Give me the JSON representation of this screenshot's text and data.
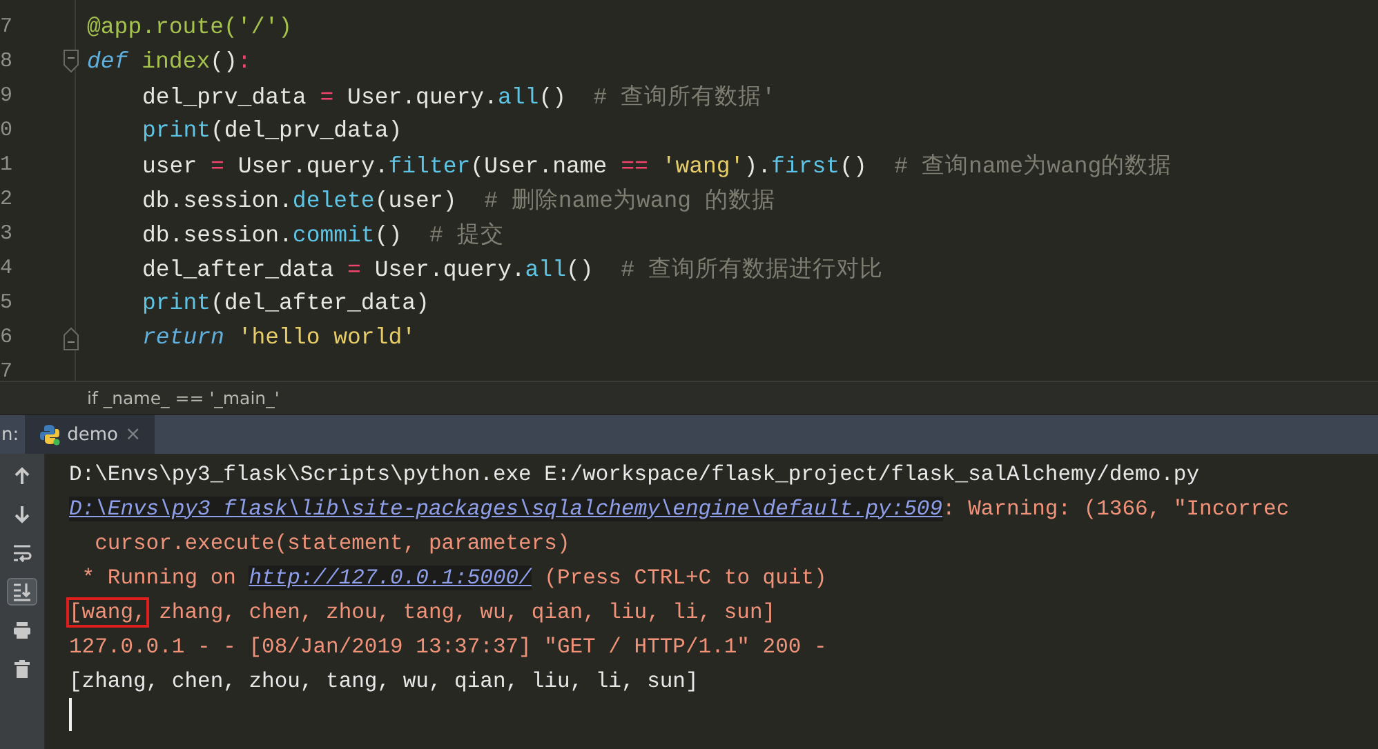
{
  "editor": {
    "lines": [
      {
        "number": "7",
        "kind": "code",
        "indented": false,
        "tokens": [
          {
            "text": "@app.route('/')",
            "kind": "deco"
          }
        ]
      },
      {
        "number": "8",
        "kind": "fold-start",
        "indented": false,
        "tokens": [
          {
            "text": "def ",
            "kind": "kw"
          },
          {
            "text": "index",
            "kind": "fn"
          },
          {
            "text": "()",
            "kind": "text"
          },
          {
            "text": ":",
            "kind": "op"
          }
        ]
      },
      {
        "number": "9",
        "kind": "code",
        "indented": true,
        "tokens": [
          {
            "text": "del_prv_data ",
            "kind": "text"
          },
          {
            "text": "=",
            "kind": "op"
          },
          {
            "text": " User.query.",
            "kind": "text"
          },
          {
            "text": "all",
            "kind": "builtin"
          },
          {
            "text": "()  ",
            "kind": "text"
          },
          {
            "text": "# 查询所有数据'",
            "kind": "comment"
          }
        ]
      },
      {
        "number": "0",
        "kind": "code",
        "indented": true,
        "tokens": [
          {
            "text": "print",
            "kind": "builtin"
          },
          {
            "text": "(del_prv_data)",
            "kind": "text"
          }
        ]
      },
      {
        "number": "1",
        "kind": "code",
        "indented": true,
        "tokens": [
          {
            "text": "user ",
            "kind": "text"
          },
          {
            "text": "=",
            "kind": "op"
          },
          {
            "text": " User.query.",
            "kind": "text"
          },
          {
            "text": "filter",
            "kind": "builtin"
          },
          {
            "text": "(User.name ",
            "kind": "text"
          },
          {
            "text": "== ",
            "kind": "op"
          },
          {
            "text": "'wang'",
            "kind": "str"
          },
          {
            "text": ").",
            "kind": "text"
          },
          {
            "text": "first",
            "kind": "builtin"
          },
          {
            "text": "()  ",
            "kind": "text"
          },
          {
            "text": "# 查询name为wang的数据",
            "kind": "comment"
          }
        ]
      },
      {
        "number": "2",
        "kind": "code",
        "indented": true,
        "tokens": [
          {
            "text": "db.session.",
            "kind": "text"
          },
          {
            "text": "delete",
            "kind": "builtin"
          },
          {
            "text": "(user)  ",
            "kind": "text"
          },
          {
            "text": "# 删除name为wang 的数据",
            "kind": "comment"
          }
        ]
      },
      {
        "number": "3",
        "kind": "code",
        "indented": true,
        "tokens": [
          {
            "text": "db.session.",
            "kind": "text"
          },
          {
            "text": "commit",
            "kind": "builtin"
          },
          {
            "text": "()  ",
            "kind": "text"
          },
          {
            "text": "# 提交",
            "kind": "comment"
          }
        ]
      },
      {
        "number": "4",
        "kind": "code",
        "indented": true,
        "tokens": [
          {
            "text": "del_after_data ",
            "kind": "text"
          },
          {
            "text": "=",
            "kind": "op"
          },
          {
            "text": " User.query.",
            "kind": "text"
          },
          {
            "text": "all",
            "kind": "builtin"
          },
          {
            "text": "()  ",
            "kind": "text"
          },
          {
            "text": "# 查询所有数据进行对比",
            "kind": "comment"
          }
        ]
      },
      {
        "number": "5",
        "kind": "code",
        "indented": true,
        "tokens": [
          {
            "text": "print",
            "kind": "builtin"
          },
          {
            "text": "(del_after_data)",
            "kind": "text"
          }
        ]
      },
      {
        "number": "6",
        "kind": "fold-end",
        "indented": true,
        "tokens": [
          {
            "text": "return ",
            "kind": "kw"
          },
          {
            "text": "'hello world'",
            "kind": "str"
          }
        ]
      },
      {
        "number": "7",
        "kind": "code"
      }
    ],
    "breadcrumb": "if _name_ == '_main_'"
  },
  "run_panel": {
    "label": "n:",
    "tabs": [
      {
        "label": "demo",
        "close": "×",
        "selected": true
      }
    ],
    "toolbar": [
      {
        "kind": "up",
        "selected": false
      },
      {
        "kind": "down",
        "selected": false
      },
      {
        "kind": "wrap",
        "selected": false
      },
      {
        "kind": "scroll-end",
        "selected": true
      },
      {
        "kind": "print",
        "selected": false
      },
      {
        "kind": "trash",
        "selected": false
      }
    ],
    "console": [
      [
        {
          "text": "D:\\Envs\\py3_flask\\Scripts\\python.exe E:/workspace/flask_project/flask_salAlchemy/demo.py",
          "kind": "plain"
        }
      ],
      [
        {
          "text": "D:\\Envs\\py3_flask\\lib\\site-packages\\sqlalchemy\\engine\\default.py:509",
          "kind": "link"
        },
        {
          "text": ": Warning: (1366, \"Incorrec",
          "kind": "error"
        }
      ],
      [
        {
          "text": "  cursor.execute(statement, parameters)",
          "kind": "error"
        }
      ],
      [
        {
          "text": " * Running on ",
          "kind": "error"
        },
        {
          "text": "http://127.0.0.1:5000/",
          "kind": "link"
        },
        {
          "text": " (Press CTRL+C to quit)",
          "kind": "error"
        }
      ],
      [
        {
          "text": "[wang,",
          "kind": "boxed"
        },
        {
          "text": " zhang, chen, zhou, tang, wu, qian, liu, li, sun]",
          "kind": "error"
        }
      ],
      [
        {
          "text": "127.0.0.1 - - [08/Jan/2019 13:37:37] \"GET / HTTP/1.1\" 200 -",
          "kind": "error"
        }
      ],
      [
        {
          "text": "[zhang, chen, zhou, tang, wu, qian, liu, li, sun]",
          "kind": "plain"
        }
      ]
    ]
  }
}
